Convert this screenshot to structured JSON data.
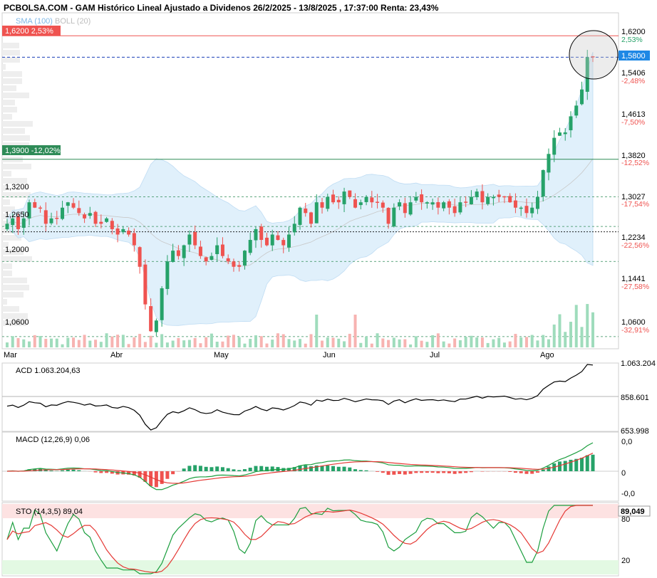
{
  "header": {
    "title": "PCBOLSA.COM - GAM Histórico Lineal Ajustado a Dividenos 26/2/2025 - 13/8/2025 , 17:37:00 Renta: 23,43%",
    "legend_sma": "SMA (100)",
    "legend_boll": "BOLL (20)"
  },
  "colors": {
    "up": "#26a269",
    "down": "#ef5350",
    "band": "#d6ebfa",
    "price_tag": "#1e88e5",
    "resistance": "#ef5350",
    "support_line": "#2e8b57",
    "stoch_high": "#fde2e2",
    "stoch_low": "#e3f9e3"
  },
  "price_panel": {
    "current_price_tag": "1,5800",
    "tags": [
      {
        "text": "1,6200  2,53%",
        "kind": "resistance"
      },
      {
        "text": "1,3900  -12,02%",
        "kind": "support"
      }
    ],
    "level_labels": [
      "1,3200",
      "1,2650",
      "1,2000",
      "1,0600"
    ],
    "axis_ticks": [
      "1,6200",
      "1,5406",
      "1,4613",
      "1,3820",
      "1,3027",
      "1,2234",
      "1,1441",
      "1,0600"
    ],
    "axis_pcts": [
      "2,53%",
      "-2,48%",
      "-7,50%",
      "-12,52%",
      "-17,54%",
      "-22,56%",
      "-27,58%",
      "-32,91%"
    ],
    "months": [
      "Mar",
      "Abr",
      "May",
      "Jun",
      "Jul",
      "Ago"
    ]
  },
  "acd_panel": {
    "label": "ACD  1.063.204,63",
    "axis_ticks": [
      "1.063.204",
      "858.601",
      "653.998"
    ]
  },
  "macd_panel": {
    "label": "MACD (12,26,9)   0,06",
    "axis_ticks": [
      "0,0",
      "0",
      "-0,0"
    ]
  },
  "sto_panel": {
    "label": "STO (14,3,5)    89,04",
    "value_tag": "89,049",
    "axis_ticks": [
      "80",
      "20"
    ]
  },
  "chart_data": {
    "type": "candlestick",
    "title": "PCBOLSA.COM - GAM Histórico Lineal Ajustado a Dividenos 26/2/2025 - 13/8/2025 , 17:37:00 Renta: 23,43%",
    "x_range": [
      "2025-02-26",
      "2025-08-13"
    ],
    "y_range": [
      1.04,
      1.66
    ],
    "closes": [
      1.27,
      1.28,
      1.26,
      1.28,
      1.31,
      1.3,
      1.3,
      1.27,
      1.28,
      1.28,
      1.3,
      1.31,
      1.3,
      1.29,
      1.28,
      1.29,
      1.27,
      1.27,
      1.28,
      1.26,
      1.25,
      1.26,
      1.25,
      1.23,
      1.19,
      1.12,
      1.07,
      1.09,
      1.15,
      1.2,
      1.22,
      1.21,
      1.23,
      1.25,
      1.23,
      1.21,
      1.2,
      1.21,
      1.23,
      1.21,
      1.2,
      1.19,
      1.19,
      1.22,
      1.24,
      1.26,
      1.24,
      1.23,
      1.25,
      1.24,
      1.23,
      1.25,
      1.27,
      1.3,
      1.29,
      1.27,
      1.31,
      1.3,
      1.32,
      1.31,
      1.31,
      1.33,
      1.32,
      1.3,
      1.31,
      1.32,
      1.31,
      1.31,
      1.3,
      1.27,
      1.3,
      1.31,
      1.29,
      1.31,
      1.32,
      1.31,
      1.31,
      1.31,
      1.3,
      1.31,
      1.3,
      1.29,
      1.31,
      1.31,
      1.32,
      1.33,
      1.31,
      1.32,
      1.32,
      1.32,
      1.32,
      1.31,
      1.3,
      1.3,
      1.29,
      1.3,
      1.32,
      1.37,
      1.4,
      1.43,
      1.44,
      1.44,
      1.47,
      1.49,
      1.52,
      1.58,
      1.58
    ],
    "support_levels": [
      1.32,
      1.265,
      1.2,
      1.06
    ],
    "resistance": 1.62,
    "support_tag": 1.39,
    "current_price": 1.58
  }
}
